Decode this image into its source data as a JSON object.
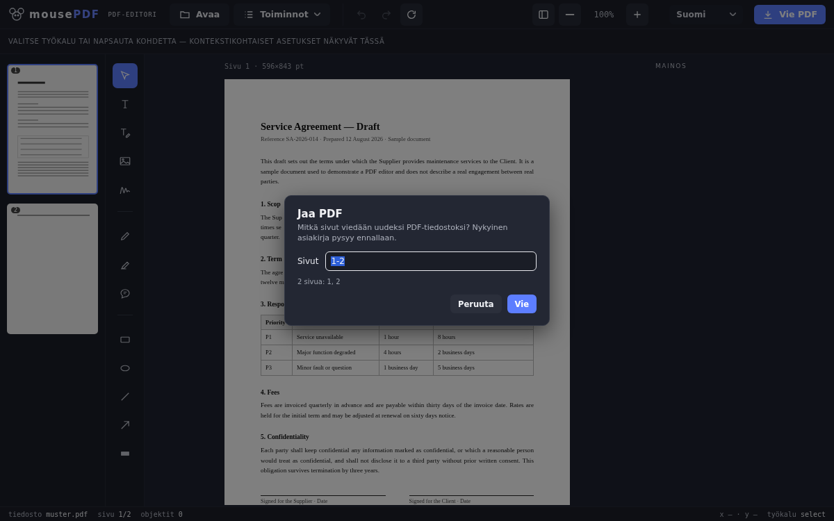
{
  "app": {
    "logo_main": "mouse",
    "logo_accent": "PDF",
    "subtitle": "PDF-EDITORI"
  },
  "toolbar": {
    "open": "Avaa",
    "actions": "Toiminnot",
    "zoom": "100%",
    "language": "Suomi",
    "export": "Vie PDF"
  },
  "history": [
    {
      "kind": "undo",
      "disabled": true
    },
    {
      "kind": "redo",
      "disabled": true
    },
    {
      "kind": "reload",
      "disabled": false
    }
  ],
  "hint": "VALITSE TYÖKALU TAI NAPSAUTA KOHDETTA — KONTEKSTIKOHTAISET ASETUKSET NÄKYVÄT TÄSSÄ",
  "thumbnails": [
    {
      "number": "1",
      "selected": true
    },
    {
      "number": "2",
      "selected": false
    }
  ],
  "tools": [
    {
      "kind": "select",
      "selected": true
    },
    {
      "kind": "text",
      "selected": false
    },
    {
      "kind": "edit-text",
      "selected": false
    },
    {
      "kind": "image",
      "selected": false
    },
    {
      "kind": "signature",
      "selected": false
    },
    {
      "kind": "divider"
    },
    {
      "kind": "pencil",
      "selected": false
    },
    {
      "kind": "highlighter",
      "selected": false
    },
    {
      "kind": "comment",
      "selected": false
    },
    {
      "kind": "divider"
    },
    {
      "kind": "rectangle",
      "selected": false
    },
    {
      "kind": "ellipse",
      "selected": false
    },
    {
      "kind": "line",
      "selected": false
    },
    {
      "kind": "arrow",
      "selected": false
    },
    {
      "kind": "redact",
      "selected": false
    }
  ],
  "canvas": {
    "page_label": "Sivu 1 · 596×843 pt"
  },
  "document": {
    "title": "Service Agreement — Draft",
    "meta": "Reference SA-2026-014 · Prepared 12 August 2026 · Sample document",
    "intro": "This draft sets out the terms under which the Supplier provides maintenance services to the Client. It is a sample document used to demonstrate a PDF editor and does not describe a real engagement between real parties.",
    "covered": [
      {
        "kind": "heading",
        "text": "1. Scop"
      },
      {
        "kind": "line",
        "text": "The Sup"
      },
      {
        "kind": "line",
        "text": "times se"
      },
      {
        "kind": "line",
        "text": "quarter."
      },
      {
        "kind": "heading",
        "text": "2. Term"
      },
      {
        "kind": "line",
        "text": "The agre"
      },
      {
        "kind": "line",
        "text": "twelve m"
      },
      {
        "kind": "heading",
        "text": "3. Respo"
      }
    ],
    "table": {
      "header": [
        "Priority"
      ],
      "rows": [
        [
          "P1",
          "Service unavailable",
          "1 hour",
          "8 hours"
        ],
        [
          "P2",
          "Major function degraded",
          "4 hours",
          "2 business days"
        ],
        [
          "P3",
          "Minor fault or question",
          "1 business day",
          "5 business days"
        ]
      ]
    },
    "sections": [
      {
        "heading": "4. Fees",
        "text": "Fees are invoiced quarterly in advance and are payable within thirty days of the invoice date. Rates are held for the initial term and may be adjusted at renewal on sixty days notice."
      },
      {
        "heading": "5. Confidentiality",
        "text": "Each party shall keep confidential any information marked as confidential, or which a reasonable person would treat as confidential, and shall not disclose it to a third party without prior written consent. This obligation survives termination by three years."
      }
    ],
    "signatures": [
      "Signed for the Supplier · Date",
      "Signed for the Client · Date"
    ]
  },
  "ad_label": "MAINOS",
  "dialog": {
    "title": "Jaa PDF",
    "description": "Mitkä sivut viedään uudeksi PDF-tiedostoksi? Nykyinen asiakirja pysyy ennallaan.",
    "field_label": "Sivut",
    "field_value": "1-2",
    "field_hint": "2 sivua: 1, 2",
    "cancel": "Peruuta",
    "confirm": "Vie"
  },
  "status_bar": {
    "items": [
      {
        "label": "tiedosto",
        "value": "muster.pdf"
      },
      {
        "label": "sivu",
        "value": "1/2"
      },
      {
        "label": "objektit",
        "value": "0"
      }
    ],
    "coords": "x – · y –",
    "tool": {
      "label": "työkalu",
      "value": "select"
    }
  }
}
